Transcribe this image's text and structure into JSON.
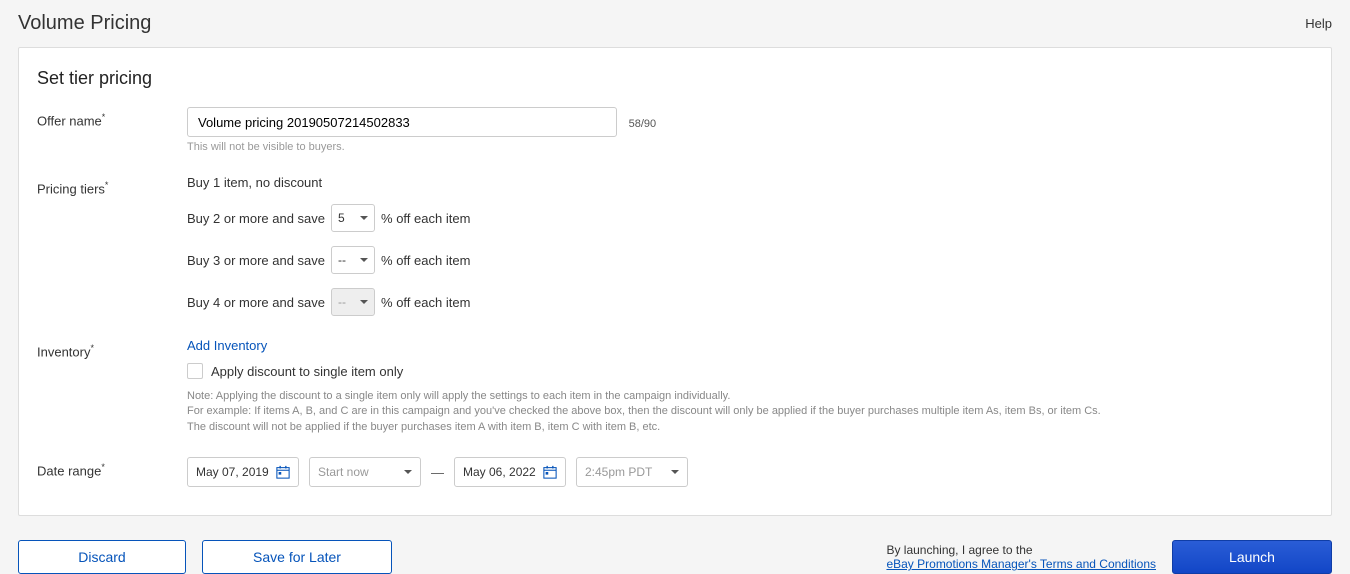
{
  "header": {
    "title": "Volume Pricing",
    "help": "Help"
  },
  "card": {
    "title": "Set tier pricing"
  },
  "offer": {
    "label": "Offer name",
    "value": "Volume pricing 20190507214502833",
    "char_count": "58/90",
    "hint": "This will not be visible to buyers."
  },
  "tiers": {
    "label": "Pricing tiers",
    "tier1": "Buy 1 item, no discount",
    "tier2_prefix": "Buy 2 or more and save",
    "tier2_value": "5",
    "tier3_prefix": "Buy 3 or more and save",
    "tier3_value": "--",
    "tier4_prefix": "Buy 4 or more and save",
    "tier4_value": "--",
    "suffix": "% off each item"
  },
  "inventory": {
    "label": "Inventory",
    "add_link": "Add Inventory",
    "checkbox_label": "Apply discount to single item only",
    "note_line1": "Note: Applying the discount to a single item only will apply the settings to each item in the campaign individually.",
    "note_line2": "For example: If items A, B, and C are in this campaign and you've checked the above box, then the discount will only be applied if the buyer purchases multiple item As, item Bs, or item Cs.",
    "note_line3": "The discount will not be applied if the buyer purchases item A with item B, item C with item B, etc."
  },
  "dates": {
    "label": "Date range",
    "start_date": "May 07, 2019",
    "start_time": "Start now",
    "dash": "—",
    "end_date": "May 06, 2022",
    "end_time": "2:45pm PDT"
  },
  "footer": {
    "discard": "Discard",
    "save": "Save for Later",
    "agree_line1": "By launching, I agree to the",
    "agree_link": "eBay Promotions Manager's Terms and Conditions",
    "launch": "Launch"
  }
}
